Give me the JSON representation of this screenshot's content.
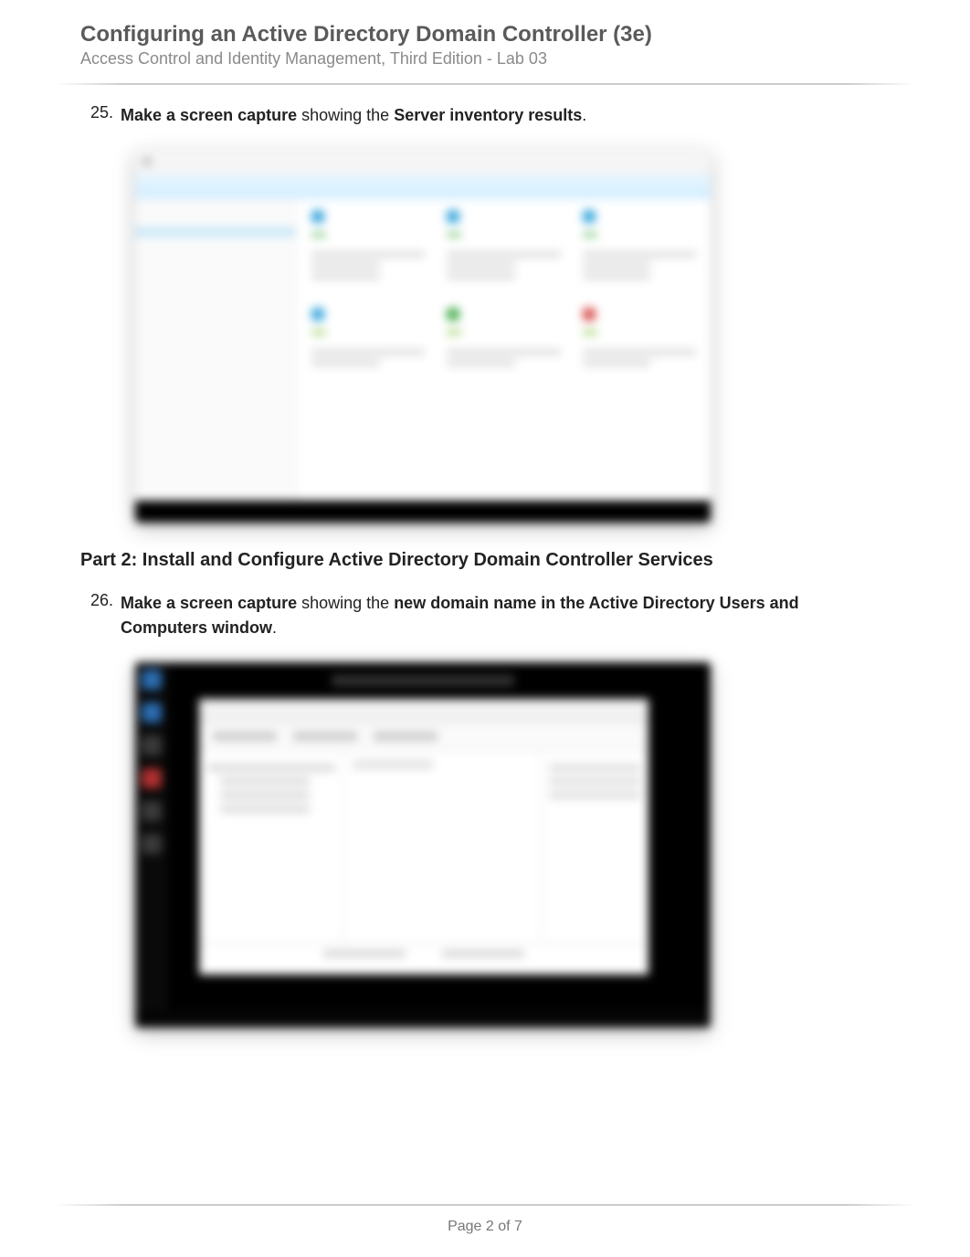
{
  "header": {
    "title": "Configuring an Active Directory Domain Controller (3e)",
    "subtitle": "Access Control and Identity Management, Third Edition - Lab 03"
  },
  "step25": {
    "number": "25.",
    "bold1": "Make a screen capture",
    "mid": " showing the ",
    "bold2": "Server inventory results",
    "tail": "."
  },
  "part2_heading": "Part 2: Install and Configure Active Directory Domain Controller Services",
  "step26": {
    "number": "26.",
    "bold1": "Make a screen capture",
    "mid": " showing the ",
    "bold2": "new domain name in the Active Directory Users and Computers window",
    "tail": "."
  },
  "footer": {
    "page": "Page 2 of 7"
  }
}
